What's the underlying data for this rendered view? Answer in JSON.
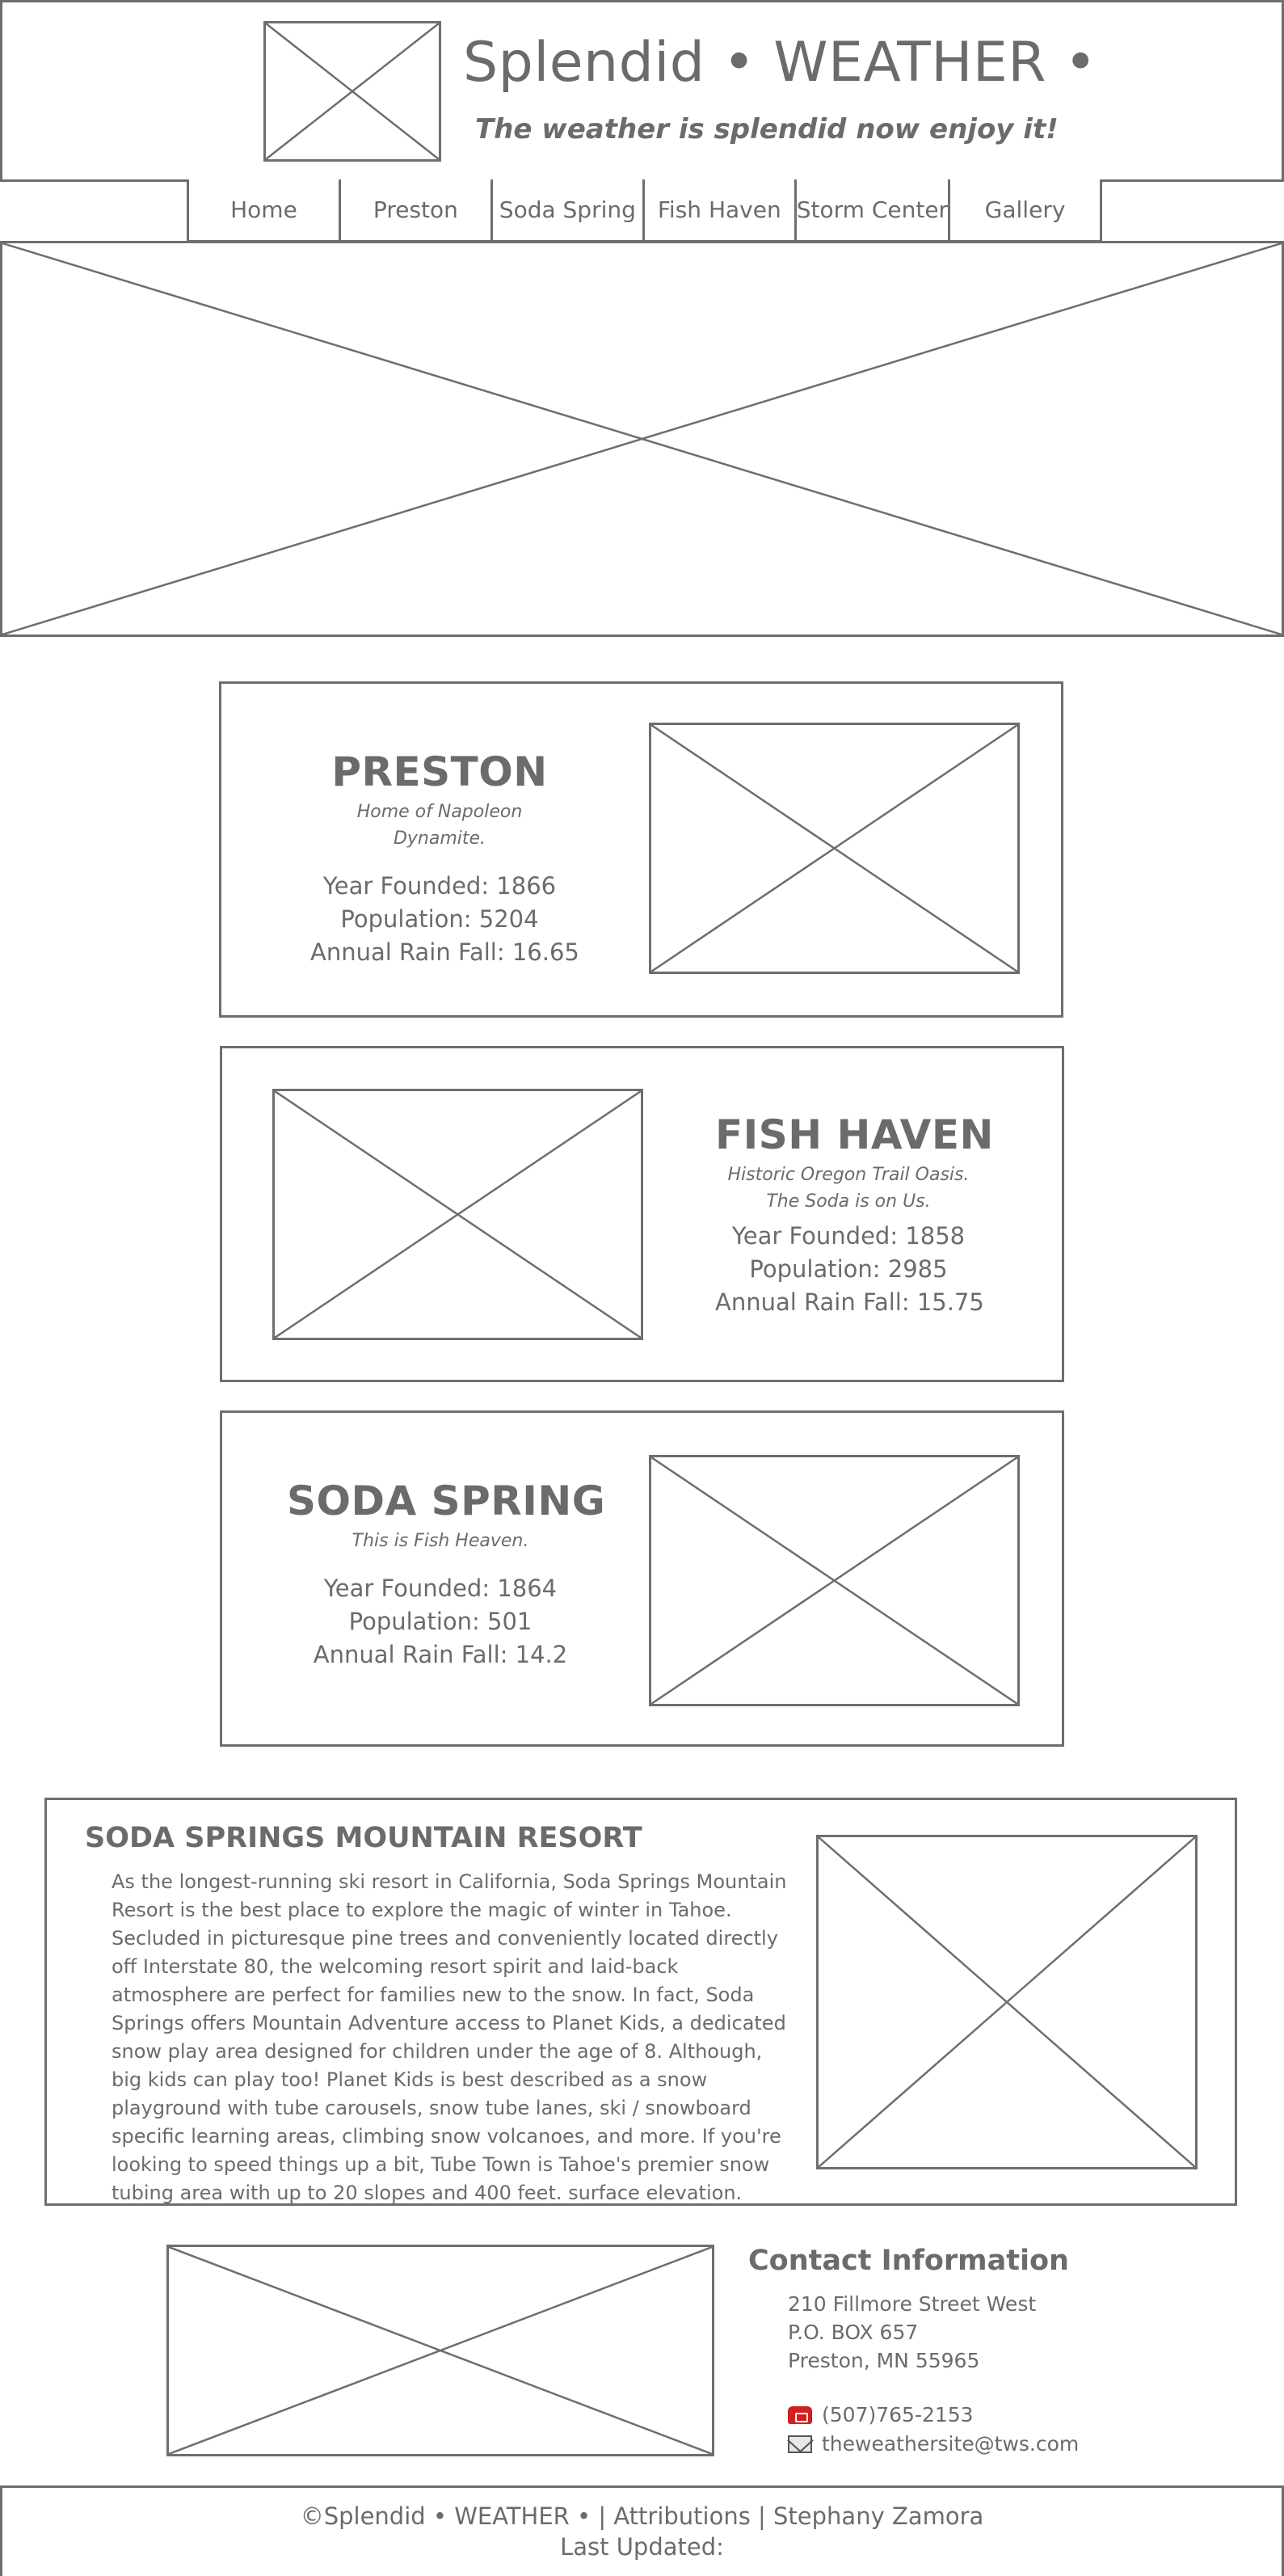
{
  "header": {
    "site_title": "Splendid • WEATHER •",
    "tagline": "The weather is splendid now enjoy it!",
    "logo_icon": "image-placeholder-icon"
  },
  "nav": {
    "items": [
      {
        "label": "Home"
      },
      {
        "label": "Preston"
      },
      {
        "label": "Soda Spring"
      },
      {
        "label": "Fish Haven"
      },
      {
        "label": "Storm Center"
      },
      {
        "label": "Gallery"
      }
    ]
  },
  "towns": {
    "preston": {
      "name": "PRESTON",
      "motto": "Home of Napoleon Dynamite.",
      "founded": "Year Founded: 1866",
      "population": "Population: 5204",
      "rainfall": "Annual Rain Fall: 16.65"
    },
    "fish_haven": {
      "name": "FISH HAVEN",
      "motto_line1": "Historic Oregon Trail Oasis.",
      "motto_line2": "The Soda is on Us.",
      "founded": "Year Founded: 1858",
      "population": "Population: 2985",
      "rainfall": "Annual Rain Fall: 15.75"
    },
    "soda_spring": {
      "name": "SODA SPRING",
      "motto": "This is Fish Heaven.",
      "founded": "Year Founded: 1864",
      "population": "Population: 501",
      "rainfall": "Annual Rain Fall: 14.2"
    }
  },
  "resort": {
    "title": "SODA SPRINGS MOUNTAIN RESORT",
    "text": "As the longest-running ski resort in California, Soda Springs Mountain Resort is the best place to explore the magic of winter in Tahoe. Secluded in picturesque pine trees and conveniently located directly off Interstate 80, the welcoming resort spirit and laid-back atmosphere are perfect for families new to the snow. In fact, Soda Springs offers Mountain Adventure access to Planet Kids, a dedicated snow play area designed for children under the age of 8. Although, big kids can play too! Planet Kids is best described as a snow playground with tube carousels, snow tube lanes, ski / snowboard specific learning areas, climbing snow volcanoes, and more. If you're looking to speed things up a bit, Tube Town is Tahoe's premier snow tubing area with up to 20 slopes and 400 feet. surface elevation."
  },
  "contact": {
    "title": "Contact Information",
    "address_line1": "210 Fillmore Street West",
    "address_line2": "P.O. BOX 657",
    "address_line3": "Preston, MN 55965",
    "phone": "(507)765-2153",
    "email": "theweathersite@tws.com",
    "phone_icon": "phone-icon",
    "email_icon": "mail-icon"
  },
  "footer": {
    "copyright": "©Splendid • WEATHER • | Attributions | Stephany Zamora",
    "last_updated": "Last Updated:"
  },
  "colors": {
    "line": "#6e6e6e",
    "text": "#6b6b6b",
    "phone_icon": "#d11e1e",
    "background": "#ffffff"
  }
}
